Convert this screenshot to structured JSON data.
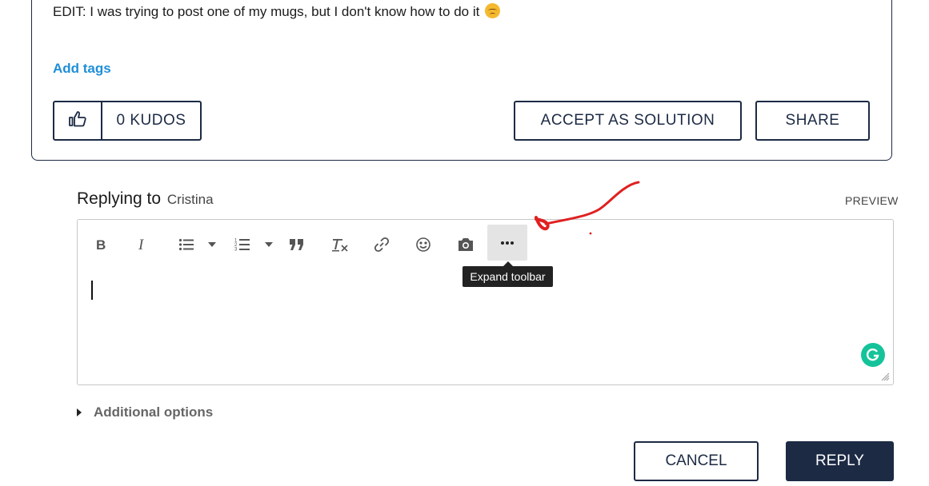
{
  "post": {
    "edit_text": "EDIT: I was trying to post one of my mugs, but I don't know how to do it",
    "edit_emoji": "disappointed-face-emoji",
    "add_tags_label": "Add tags",
    "kudos_label": "0 KUDOS",
    "accept_label": "ACCEPT AS SOLUTION",
    "share_label": "SHARE"
  },
  "reply": {
    "heading": "Replying to",
    "recipient": "Cristina",
    "preview_label": "PREVIEW"
  },
  "toolbar": {
    "items": [
      {
        "icon": "bold-icon"
      },
      {
        "icon": "italic-icon"
      },
      {
        "icon": "bulleted-list-icon"
      },
      {
        "icon": "chevron-down-icon"
      },
      {
        "icon": "numbered-list-icon"
      },
      {
        "icon": "chevron-down-icon"
      },
      {
        "icon": "blockquote-icon"
      },
      {
        "icon": "clear-formatting-icon"
      },
      {
        "icon": "link-icon"
      },
      {
        "icon": "emoji-icon"
      },
      {
        "icon": "camera-icon"
      },
      {
        "icon": "more-icon"
      }
    ],
    "tooltip": "Expand toolbar"
  },
  "editor": {
    "grammarly_icon": "grammarly-icon"
  },
  "footer": {
    "additional_options_label": "Additional options",
    "cancel_label": "CANCEL",
    "reply_label": "REPLY"
  },
  "colors": {
    "navy": "#1c2a44",
    "link_blue": "#1f8ed8",
    "grammarly_green": "#15c39a",
    "annotation_red": "#e02020"
  }
}
